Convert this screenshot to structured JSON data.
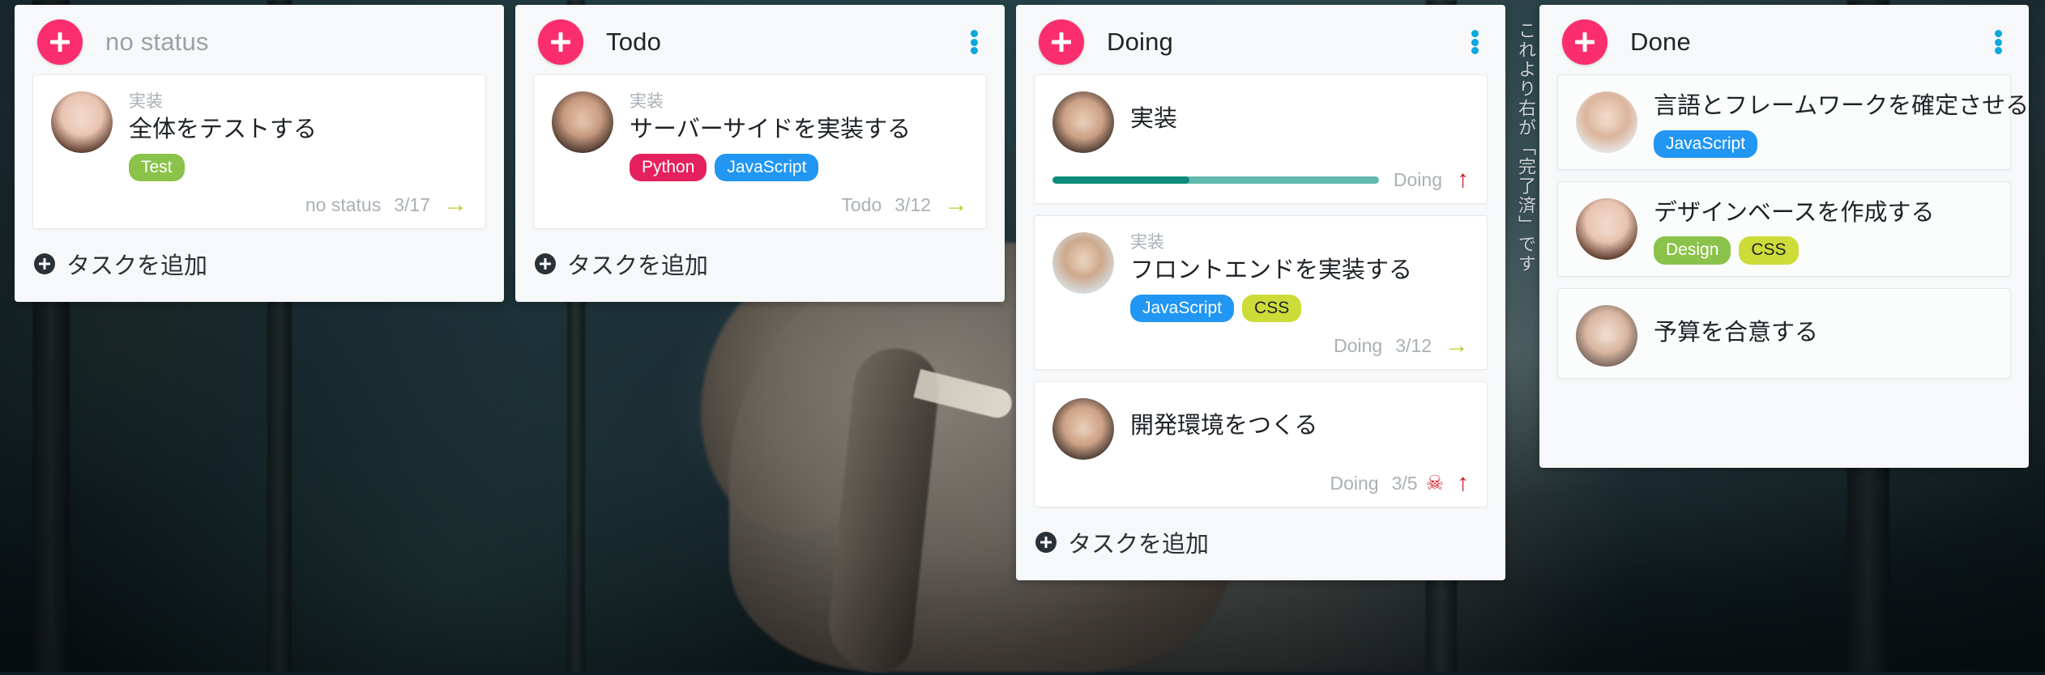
{
  "board": {
    "divider_note": "これより右が「完了済」です",
    "add_task_label": "タスクを追加",
    "columns": [
      {
        "id": "no-status",
        "title": "no status",
        "title_muted": true,
        "has_kebab": false,
        "has_add_task": true,
        "cards": [
          {
            "kind": "実装",
            "title": "全体をテストする",
            "avatar": "a1",
            "tags": [
              {
                "label": "Test",
                "color": "#8bc34a",
                "text_color": "#ffffff"
              }
            ],
            "footer": {
              "status": "no status",
              "date": "3/17",
              "arrow": "right"
            }
          }
        ]
      },
      {
        "id": "todo",
        "title": "Todo",
        "title_muted": false,
        "has_kebab": true,
        "has_add_task": true,
        "cards": [
          {
            "kind": "実装",
            "title": "サーバーサイドを実装する",
            "avatar": "a2",
            "tags": [
              {
                "label": "Python",
                "color": "#e5205f",
                "text_color": "#ffffff"
              },
              {
                "label": "JavaScript",
                "color": "#2196f3",
                "text_color": "#ffffff"
              }
            ],
            "footer": {
              "status": "Todo",
              "date": "3/12",
              "arrow": "right"
            }
          }
        ]
      },
      {
        "id": "doing",
        "title": "Doing",
        "title_muted": false,
        "has_kebab": true,
        "has_add_task": true,
        "cards": [
          {
            "kind": "",
            "title": "実装",
            "avatar": "a3",
            "tags": [],
            "progress": {
              "percent": 42,
              "fill_color": "#0d8c7c",
              "track_color": "#62b9b0"
            },
            "footer": {
              "status": "Doing",
              "date": "",
              "arrow": "up"
            }
          },
          {
            "kind": "実装",
            "title": "フロントエンドを実装する",
            "avatar": "a4",
            "tags": [
              {
                "label": "JavaScript",
                "color": "#2196f3",
                "text_color": "#ffffff"
              },
              {
                "label": "CSS",
                "color": "#cddc39",
                "text_color": "#1d2228"
              }
            ],
            "footer": {
              "status": "Doing",
              "date": "3/12",
              "arrow": "right"
            }
          },
          {
            "kind": "",
            "title": "開発環境をつくる",
            "avatar": "a3",
            "tags": [],
            "footer": {
              "status": "Doing",
              "date": "3/5",
              "skull": true,
              "arrow": "up"
            }
          }
        ]
      },
      {
        "id": "done",
        "title": "Done",
        "title_muted": false,
        "has_kebab": true,
        "has_add_task": false,
        "cards": [
          {
            "kind": "",
            "title": "言語とフレームワークを確定させる",
            "avatar": "a5",
            "tags": [
              {
                "label": "JavaScript",
                "color": "#2196f3",
                "text_color": "#ffffff"
              }
            ],
            "footer": null
          },
          {
            "kind": "",
            "title": "デザインベースを作成する",
            "avatar": "a1",
            "tags": [
              {
                "label": "Design",
                "color": "#8bc34a",
                "text_color": "#ffffff"
              },
              {
                "label": "CSS",
                "color": "#cddc39",
                "text_color": "#1d2228"
              }
            ],
            "footer": null
          },
          {
            "kind": "",
            "title": "予算を合意する",
            "avatar": "a6",
            "tags": [],
            "footer": null
          }
        ]
      }
    ]
  },
  "icons": {
    "arrow_right": "→",
    "arrow_up": "↑",
    "skull": "☠"
  },
  "colors": {
    "accent_pink": "#fa2e6e",
    "kebab_blue": "#0aa7e0",
    "arrow_right": "#c2c92a",
    "arrow_up": "#cf1f27",
    "skull": "#cf1f27",
    "column_bg": "#f7f8f9",
    "card_bg": "#ffffff"
  }
}
